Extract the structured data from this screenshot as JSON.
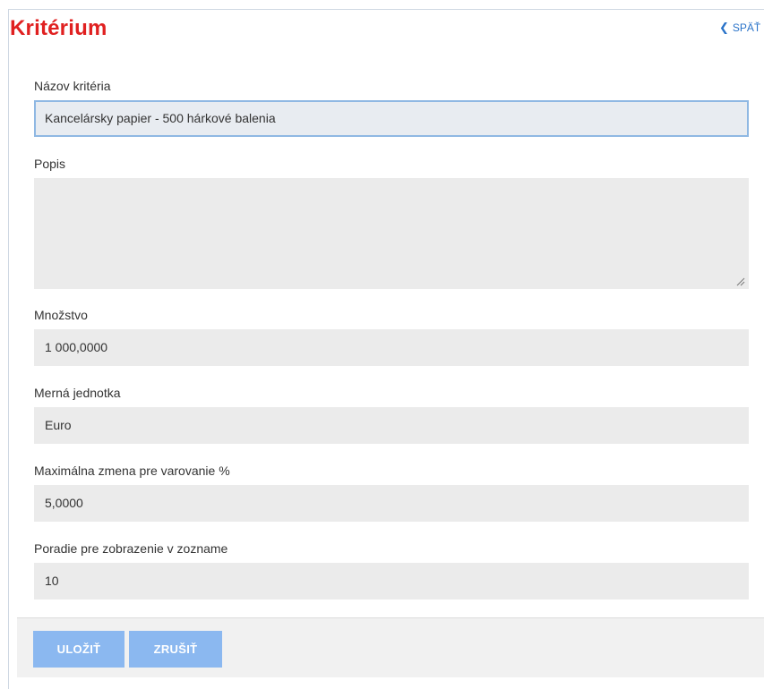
{
  "header": {
    "title": "Kritérium",
    "back_label": "SPÄŤ"
  },
  "form": {
    "name": {
      "label": "Názov kritéria",
      "value": "Kancelársky papier - 500 hárkové balenia"
    },
    "description": {
      "label": "Popis",
      "value": ""
    },
    "quantity": {
      "label": "Množstvo",
      "value": "1 000,0000"
    },
    "unit": {
      "label": "Merná jednotka",
      "value": "Euro"
    },
    "max_change": {
      "label": "Maximálna zmena pre varovanie %",
      "value": "5,0000"
    },
    "order": {
      "label": "Poradie pre zobrazenie v zozname",
      "value": "10"
    }
  },
  "footer": {
    "save_label": "ULOŽIŤ",
    "cancel_label": "ZRUŠIŤ"
  },
  "colors": {
    "title": "#e02020",
    "link": "#2a73c9",
    "button": "#8bb8f0",
    "field_bg": "#ebebeb",
    "focus_border": "#8fb8e3"
  }
}
